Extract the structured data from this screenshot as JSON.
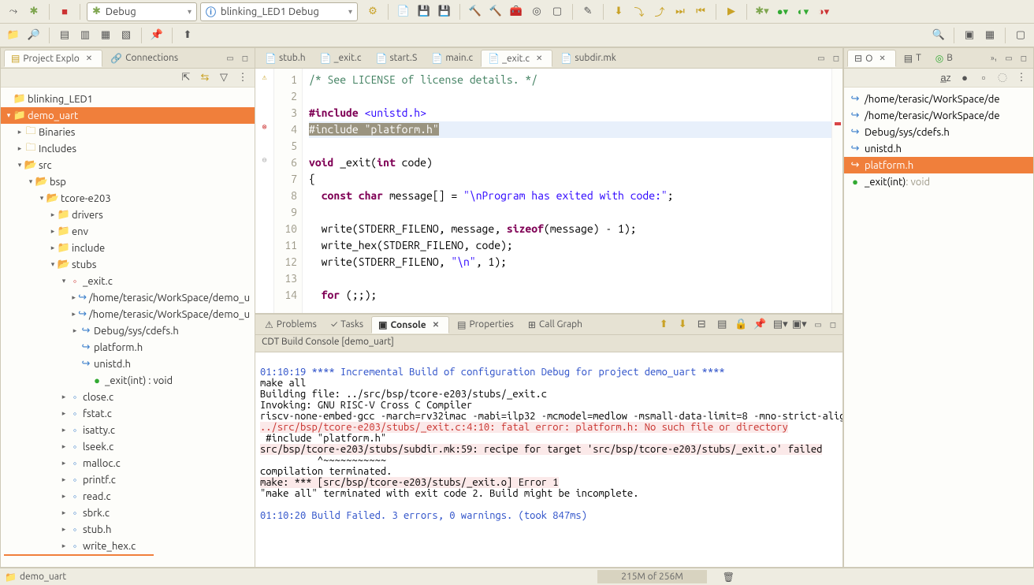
{
  "toolbar": {
    "combo1": "Debug",
    "combo2": "blinking_LED1 Debug"
  },
  "left_panel": {
    "tab1": "Project Explo",
    "tab2": "Connections"
  },
  "project_tree": {
    "blinking": "blinking_LED1",
    "demo": "demo_uart",
    "binaries": "Binaries",
    "includes": "Includes",
    "src": "src",
    "bsp": "bsp",
    "tcore": "tcore-e203",
    "drivers": "drivers",
    "env": "env",
    "include": "include",
    "stubs": "stubs",
    "exitc": "_exit.c",
    "home1": "/home/terasic/WorkSpace/demo_u",
    "home2": "/home/terasic/WorkSpace/demo_u",
    "cdefs": "Debug/sys/cdefs.h",
    "platformh": "platform.h",
    "unistdh": "unistd.h",
    "exitfn": "_exit(int) : void",
    "closec": "close.c",
    "fstatc": "fstat.c",
    "isattyc": "isatty.c",
    "lseekc": "lseek.c",
    "mallocc": "malloc.c",
    "printfc": "printf.c",
    "readc": "read.c",
    "sbrkc": "sbrk.c",
    "stubh": "stub.h",
    "writehex": "write_hex.c"
  },
  "editor_tabs": {
    "t1": "stub.h",
    "t2": "_exit.c",
    "t3": "start.S",
    "t4": "main.c",
    "t5": "_exit.c",
    "t6": "subdir.mk"
  },
  "code": {
    "l1": "/* See LICENSE of license details. */",
    "l2": "",
    "l3a": "#include",
    "l3b": " <unistd.h>",
    "l4a": "#include",
    "l4b": " \"platform.h\"",
    "l5": "",
    "l6a": "void",
    "l6b": " _exit(",
    "l6c": "int",
    "l6d": " code)",
    "l7": "{",
    "l8a": "  ",
    "l8b": "const",
    "l8c": " ",
    "l8d": "char",
    "l8e": " message[] = ",
    "l8f": "\"\\nProgram has exited with code:\"",
    "l8g": ";",
    "l9": "",
    "l10a": "  write(STDERR_FILENO, message, ",
    "l10b": "sizeof",
    "l10c": "(message) - 1);",
    "l11": "  write_hex(STDERR_FILENO, code);",
    "l12a": "  write(STDERR_FILENO, ",
    "l12b": "\"\\n\"",
    "l12c": ", 1);",
    "l13": "",
    "l14a": "  ",
    "l14b": "for",
    "l14c": " (;;);"
  },
  "line_numbers": [
    "1",
    "2",
    "3",
    "4",
    "5",
    "6",
    "7",
    "8",
    "9",
    "10",
    "11",
    "12",
    "13",
    "14"
  ],
  "bottom_tabs": {
    "problems": "Problems",
    "tasks": "Tasks",
    "console": "Console",
    "properties": "Properties",
    "callgraph": "Call Graph"
  },
  "console": {
    "header": "CDT Build Console [demo_uart]",
    "l1": "01:10:19 **** Incremental Build of configuration Debug for project demo_uart ****",
    "l2": "make all ",
    "l3": "Building file: ../src/bsp/tcore-e203/stubs/_exit.c",
    "l4": "Invoking: GNU RISC-V Cross C Compiler",
    "l5": "riscv-none-embed-gcc -march=rv32imac -mabi=ilp32 -mcmodel=medlow -msmall-data-limit=8 -mno-strict-align -mno-save-restore ",
    "l6": "../src/bsp/tcore-e203/stubs/_exit.c:4:10: fatal error: platform.h: No such file or directory",
    "l7": " #include \"platform.h\"",
    "l8": "src/bsp/tcore-e203/stubs/subdir.mk:59: recipe for target 'src/bsp/tcore-e203/stubs/_exit.o' failed",
    "l9": "          ^~~~~~~~~~~~",
    "l10": "compilation terminated.",
    "l11": "make: *** [src/bsp/tcore-e203/stubs/_exit.o] Error 1",
    "l12": "\"make all\" terminated with exit code 2. Build might be incomplete.",
    "l13": "",
    "l14": "01:10:20 Build Failed. 3 errors, 0 warnings. (took 847ms)"
  },
  "outline": {
    "tab1": "O",
    "tab2": "T",
    "tab3": "B",
    "i1": "/home/terasic/WorkSpace/de",
    "i2": "/home/terasic/WorkSpace/de",
    "i3": "Debug/sys/cdefs.h",
    "i4": "unistd.h",
    "i5": "platform.h",
    "i6a": "_exit(int)",
    "i6b": " : void"
  },
  "status": {
    "left": "demo_uart",
    "heap": "215M of 256M"
  }
}
